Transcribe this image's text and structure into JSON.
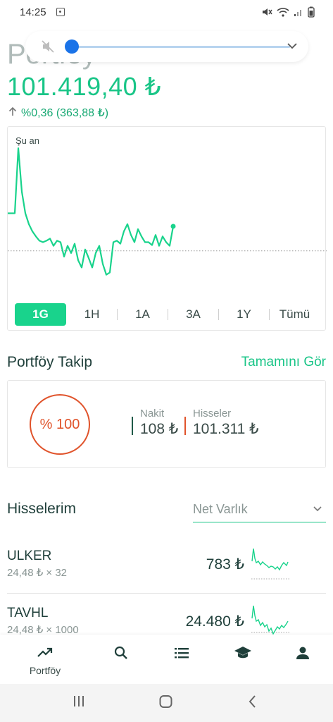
{
  "status": {
    "time": "14:25"
  },
  "page": {
    "title": "Portföy",
    "total_value": "101.419,40 ₺",
    "change_text": "%0,36 (363,88 ₺)"
  },
  "chart": {
    "now_label": "Şu an",
    "periods": [
      "1G",
      "1H",
      "1A",
      "3A",
      "1Y",
      "Tümü"
    ],
    "selected_period": "1G",
    "line_color": "#19d38c"
  },
  "chart_data": {
    "type": "line",
    "series": [
      {
        "values": [
          100.0,
          100.0,
          100.0,
          100.9,
          100.3,
          100.0,
          99.85,
          99.75,
          99.68,
          99.62,
          99.6,
          99.62,
          99.65,
          99.55,
          99.62,
          99.6,
          99.4,
          99.55,
          99.45,
          99.58,
          99.35,
          99.25,
          99.5,
          99.38,
          99.25,
          99.45,
          99.55,
          99.3,
          99.15,
          99.18,
          99.6,
          99.62,
          99.58,
          99.75,
          99.85,
          99.7,
          99.6,
          99.78,
          99.68,
          99.6,
          99.6,
          99.56,
          99.7,
          99.55,
          99.68,
          99.6,
          99.55,
          99.82
        ]
      }
    ],
    "baseline": 99.48
  },
  "takip": {
    "title": "Portföy Takip",
    "see_all": "Tamamını Gör",
    "ring_label": "% 100",
    "ring_percent": 100,
    "cash_label": "Nakit",
    "cash_value": "108 ₺",
    "stocks_label": "Hisseler",
    "stocks_value": "101.311 ₺"
  },
  "holdings": {
    "title": "Hisselerim",
    "sort_value": "Net Varlık",
    "items": [
      {
        "symbol": "ULKER",
        "detail": "24,48 ₺ × 32",
        "value": "783 ₺"
      },
      {
        "symbol": "TAVHL",
        "detail": "24,48 ₺ × 1000",
        "value": "24.480 ₺"
      }
    ]
  },
  "bottom_nav": {
    "portfolio_label": "Portföy"
  },
  "colors": {
    "accent": "#19c587",
    "cash_bar": "#1f5a48",
    "stocks_bar": "#e0532b"
  }
}
